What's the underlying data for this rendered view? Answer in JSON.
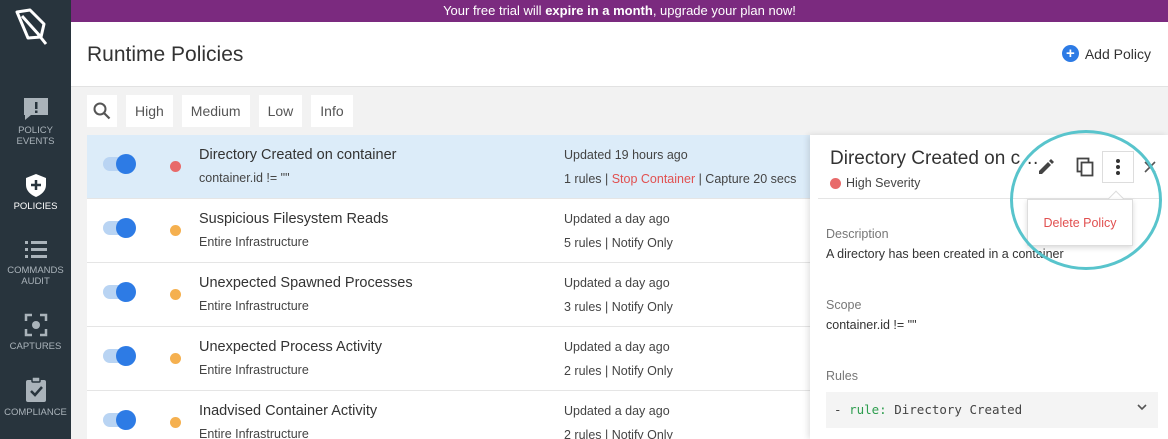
{
  "sidebar": {
    "items": [
      {
        "label_line1": "POLICY",
        "label_line2": "EVENTS",
        "icon": "alert-message-icon"
      },
      {
        "label_line1": "POLICIES",
        "label_line2": "",
        "icon": "shield-plus-icon"
      },
      {
        "label_line1": "COMMANDS",
        "label_line2": "AUDIT",
        "icon": "list-icon"
      },
      {
        "label_line1": "CAPTURES",
        "label_line2": "",
        "icon": "capture-icon"
      },
      {
        "label_line1": "COMPLIANCE",
        "label_line2": "",
        "icon": "clipboard-check-icon"
      }
    ]
  },
  "banner": {
    "text_before": "Your free trial will ",
    "text_bold": "expire in a month",
    "text_after": ", upgrade your plan now!"
  },
  "header": {
    "title": "Runtime Policies",
    "add_label": "Add Policy"
  },
  "filters": [
    "High",
    "Medium",
    "Low",
    "Info"
  ],
  "policies": [
    {
      "name": "Directory Created on container",
      "scope": "container.id != \"\"",
      "updated": "Updated 19 hours ago",
      "actions_prefix": "1 rules | ",
      "actions_stop": "Stop Container",
      "actions_suffix": " | Capture 20 secs",
      "severity": "high"
    },
    {
      "name": "Suspicious Filesystem Reads",
      "scope": "Entire Infrastructure",
      "updated": "Updated a day ago",
      "actions_prefix": "5 rules | Notify Only",
      "actions_stop": "",
      "actions_suffix": "",
      "severity": "medium"
    },
    {
      "name": "Unexpected Spawned Processes",
      "scope": "Entire Infrastructure",
      "updated": "Updated a day ago",
      "actions_prefix": "3 rules | Notify Only",
      "actions_stop": "",
      "actions_suffix": "",
      "severity": "medium"
    },
    {
      "name": "Unexpected Process Activity",
      "scope": "Entire Infrastructure",
      "updated": "Updated a day ago",
      "actions_prefix": "2 rules | Notify Only",
      "actions_stop": "",
      "actions_suffix": "",
      "severity": "medium"
    },
    {
      "name": "Inadvised Container Activity",
      "scope": "Entire Infrastructure",
      "updated": "Updated a day ago",
      "actions_prefix": "2 rules | Notify Only",
      "actions_stop": "",
      "actions_suffix": "",
      "severity": "medium"
    }
  ],
  "panel": {
    "title": "Directory Created on container",
    "severity": "High Severity",
    "description_label": "Description",
    "description": "A directory has been created in a container",
    "scope_label": "Scope",
    "scope": "container.id != \"\"",
    "rules_label": "Rules",
    "rule_keyword": "rule:",
    "rule_prefix": "- ",
    "rule_name": " Directory Created"
  },
  "menu": {
    "delete_label": "Delete Policy"
  },
  "colors": {
    "high": "#e86a6a",
    "medium": "#f5b04f",
    "accent": "#2d7be5",
    "banner": "#7b2a7f",
    "danger": "#e15050",
    "highlight": "#58c4cc"
  }
}
